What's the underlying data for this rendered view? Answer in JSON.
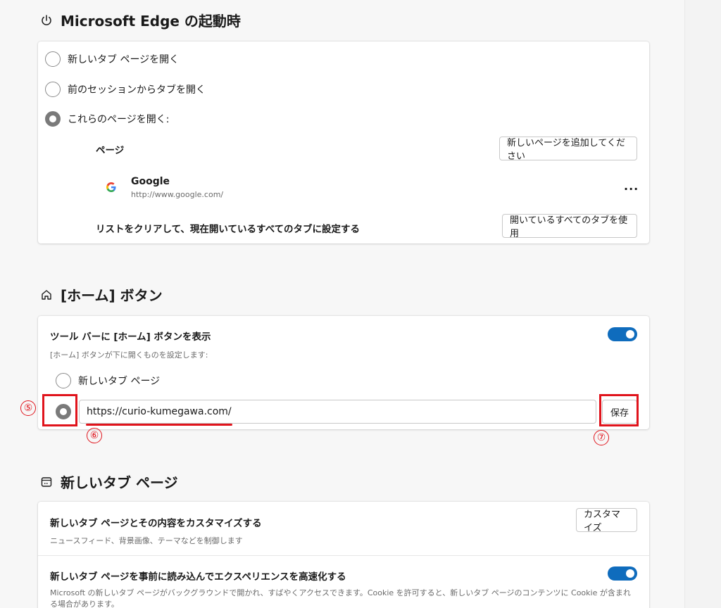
{
  "startup": {
    "title": "Microsoft Edge の起動時",
    "options": [
      {
        "label": "新しいタブ ページを開く",
        "checked": false
      },
      {
        "label": "前のセッションからタブを開く",
        "checked": false
      },
      {
        "label": "これらのページを開く:",
        "checked": true
      }
    ],
    "pages_header": "ページ",
    "add_page_button": "新しいページを追加してください",
    "page_entry": {
      "name": "Google",
      "url": "http://www.google.com/",
      "icon": "google-g-icon",
      "menu": "..."
    },
    "clear_list_label": "リストをクリアして、現在開いているすべてのタブに設定する",
    "use_open_tabs_button": "開いているすべてのタブを使用"
  },
  "home": {
    "title": "[ホーム] ボタン",
    "show_button_label": "ツール バーに [ホーム] ボタンを表示",
    "show_button_on": true,
    "description": "[ホーム] ボタンが下に開くものを設定します:",
    "option_new_tab": "新しいタブ ページ",
    "url_value": "https://curio-kumegawa.com/",
    "save_button": "保存"
  },
  "new_tab_page": {
    "title": "新しいタブ ページ",
    "customize_label": "新しいタブ ページとその内容をカスタマイズする",
    "customize_desc": "ニュースフィード、背景画像、テーマなどを制御します",
    "customize_button": "カスタマイズ",
    "preload_label": "新しいタブ ページを事前に読み込んでエクスペリエンスを高速化する",
    "preload_on": true,
    "preload_desc": "Microsoft の新しいタブ ページがバックグラウンドで開かれ、すばやくアクセスできます。Cookie を許可すると、新しいタブ ページのコンテンツに Cookie が含まれる場合があります。"
  },
  "annotations": {
    "num5": "⑤",
    "num6": "⑥",
    "num7": "⑦",
    "color": "#e0141c"
  },
  "colors": {
    "accent": "#0f6cbd",
    "background": "#f7f7f7"
  }
}
